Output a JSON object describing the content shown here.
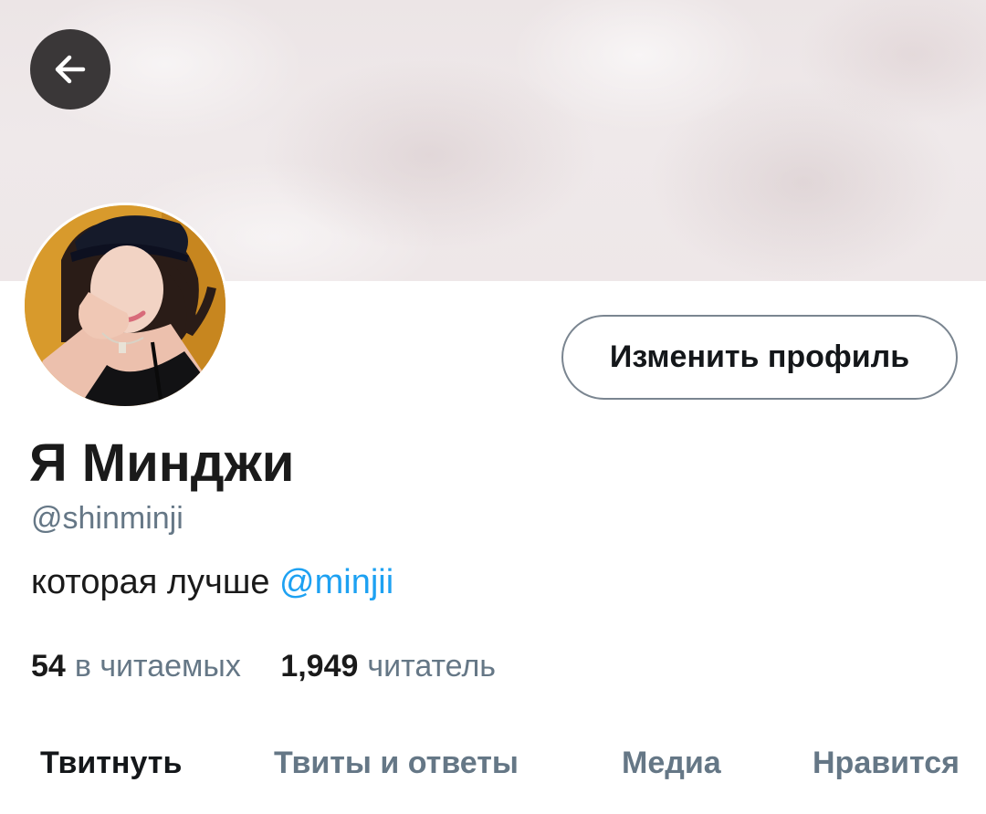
{
  "header": {
    "back_icon": "arrow-left-icon"
  },
  "profile": {
    "display_name": "Я Минджи",
    "handle": "@shinminji",
    "bio_text": "которая лучше",
    "bio_mention": "@minjii",
    "edit_button_label": "Изменить профиль",
    "avatar_icon": "profile-photo"
  },
  "stats": {
    "following_count": "54",
    "following_label": "в читаемых",
    "followers_count": "1,949",
    "followers_label": "читатель"
  },
  "tabs": [
    {
      "label": "Твитнуть",
      "active": true
    },
    {
      "label": "Твиты и ответы",
      "active": false
    },
    {
      "label": "Медиа",
      "active": false
    },
    {
      "label": "Нравится",
      "active": false
    }
  ],
  "colors": {
    "accent": "#1da1f2",
    "muted_text": "#657786",
    "primary_text": "#14171a",
    "back_button_bg": "#3a3738",
    "button_border": "#7a8590"
  }
}
